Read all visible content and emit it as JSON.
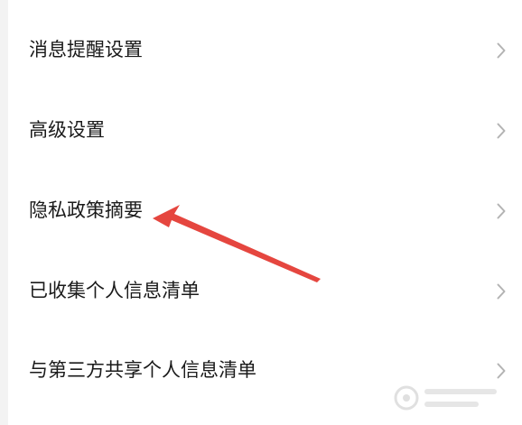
{
  "settings_menu": {
    "items": [
      {
        "label": "消息提醒设置"
      },
      {
        "label": "高级设置"
      },
      {
        "label": "隐私政策摘要"
      },
      {
        "label": "已收集个人信息清单"
      },
      {
        "label": "与第三方共享个人信息清单"
      }
    ]
  },
  "colors": {
    "background": "#ffffff",
    "text": "#1a1a1a",
    "chevron": "#b3b3b3",
    "annotation_arrow": "#e5463f"
  },
  "icons": {
    "chevron": "chevron-right-icon",
    "annotation": "red-arrow-annotation"
  }
}
